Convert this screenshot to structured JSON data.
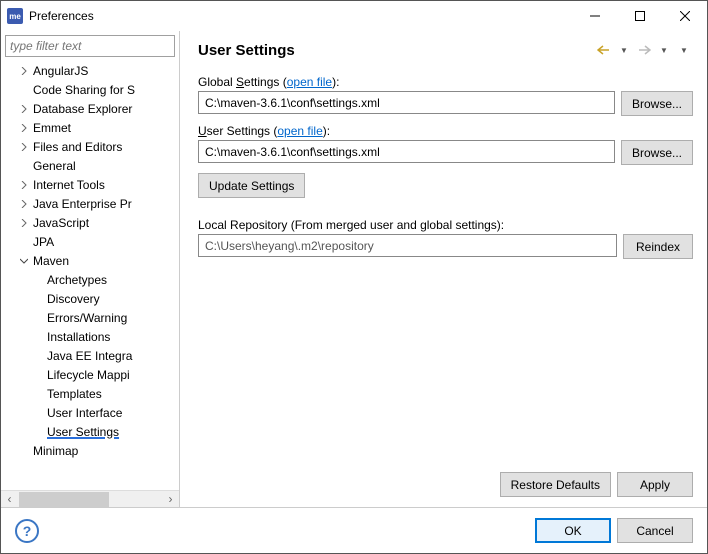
{
  "window": {
    "title": "Preferences",
    "icon_text": "me"
  },
  "filter": {
    "placeholder": "type filter text"
  },
  "tree": [
    {
      "level": 0,
      "arrow": ">",
      "label": "AngularJS"
    },
    {
      "level": 0,
      "arrow": "",
      "label": "Code Sharing for S"
    },
    {
      "level": 0,
      "arrow": ">",
      "label": "Database Explorer"
    },
    {
      "level": 0,
      "arrow": ">",
      "label": "Emmet"
    },
    {
      "level": 0,
      "arrow": ">",
      "label": "Files and Editors"
    },
    {
      "level": 0,
      "arrow": "",
      "label": "General"
    },
    {
      "level": 0,
      "arrow": ">",
      "label": "Internet Tools"
    },
    {
      "level": 0,
      "arrow": ">",
      "label": "Java Enterprise Pr"
    },
    {
      "level": 0,
      "arrow": ">",
      "label": "JavaScript"
    },
    {
      "level": 0,
      "arrow": "",
      "label": "JPA"
    },
    {
      "level": 0,
      "arrow": "v",
      "label": "Maven"
    },
    {
      "level": 1,
      "arrow": "",
      "label": "Archetypes"
    },
    {
      "level": 1,
      "arrow": "",
      "label": "Discovery"
    },
    {
      "level": 1,
      "arrow": "",
      "label": "Errors/Warning"
    },
    {
      "level": 1,
      "arrow": "",
      "label": "Installations"
    },
    {
      "level": 1,
      "arrow": "",
      "label": "Java EE Integra"
    },
    {
      "level": 1,
      "arrow": "",
      "label": "Lifecycle Mappi"
    },
    {
      "level": 1,
      "arrow": "",
      "label": "Templates"
    },
    {
      "level": 1,
      "arrow": "",
      "label": "User Interface"
    },
    {
      "level": 1,
      "arrow": "",
      "label": "User Settings",
      "selected": true
    },
    {
      "level": 0,
      "arrow": "",
      "label": "Minimap"
    }
  ],
  "page": {
    "title": "User Settings",
    "global_label_pre": "Global ",
    "global_label_key": "S",
    "global_label_post": "ettings (",
    "open_file": "open file",
    "close_paren": "):",
    "global_value": "C:\\maven-3.6.1\\conf\\settings.xml",
    "user_label_pre": "",
    "user_label_key": "U",
    "user_label_post": "ser Settings (",
    "user_value": "C:\\maven-3.6.1\\conf\\settings.xml",
    "browse": "Browse...",
    "update": "Update Settings",
    "repo_label": "Local Repository (From merged user and global settings):",
    "repo_value": "C:\\Users\\heyang\\.m2\\repository",
    "reindex": "Reindex",
    "restore": "Restore Defaults",
    "apply": "Apply",
    "ok": "OK",
    "cancel": "Cancel"
  }
}
